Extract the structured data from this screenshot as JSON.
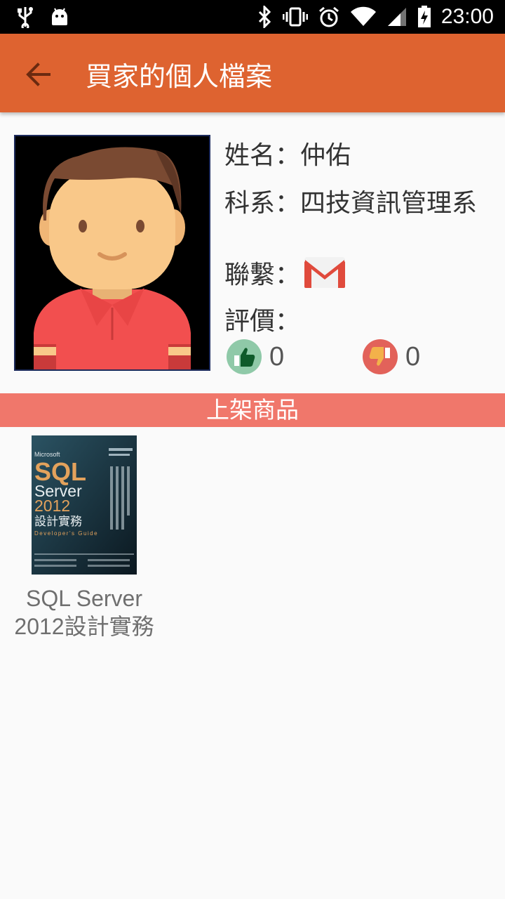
{
  "status_bar": {
    "time": "23:00"
  },
  "app_bar": {
    "title": "買家的個人檔案"
  },
  "profile": {
    "name_line": "姓名：仲佑",
    "dept_line": "科系：四技資訊管理系",
    "contact_label": "聯繫：",
    "rating_label": "評價：",
    "likes": "0",
    "dislikes": "0"
  },
  "section": {
    "title": "上架商品"
  },
  "products": [
    {
      "name_line1": "SQL Server",
      "name_line2": "2012設計實務",
      "cover": {
        "brand": "Microsoft",
        "line1": "SQL",
        "line2": "Server",
        "line3": "2012",
        "line4": "設計實務",
        "subtitle": "Developer's Guide"
      }
    }
  ],
  "colors": {
    "app_bar": "#de6330",
    "section_bar": "#f0776b",
    "like": "#8fc9a8",
    "dislike": "#e2625a"
  }
}
